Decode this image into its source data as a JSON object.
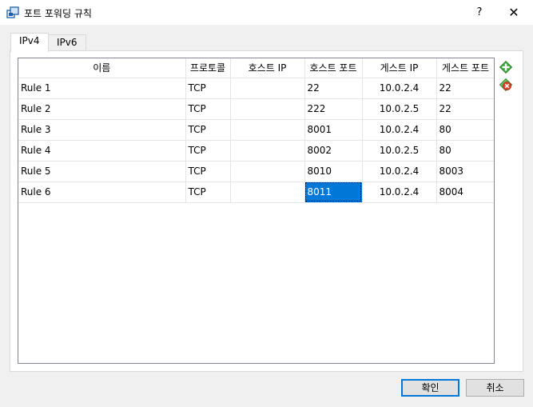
{
  "window": {
    "title": "포트 포워딩 규칙",
    "help_label": "?",
    "close_label": "✕"
  },
  "tabs": [
    {
      "label": "IPv4",
      "active": true
    },
    {
      "label": "IPv6",
      "active": false
    }
  ],
  "table": {
    "columns": [
      "이름",
      "프로토콜",
      "호스트 IP",
      "호스트 포트",
      "게스트 IP",
      "게스트 포트"
    ],
    "rows": [
      [
        "Rule 1",
        "TCP",
        "",
        "22",
        "10.0.2.4",
        "22"
      ],
      [
        "Rule 2",
        "TCP",
        "",
        "222",
        "10.0.2.5",
        "22"
      ],
      [
        "Rule 3",
        "TCP",
        "",
        "8001",
        "10.0.2.4",
        "80"
      ],
      [
        "Rule 4",
        "TCP",
        "",
        "8002",
        "10.0.2.5",
        "80"
      ],
      [
        "Rule 5",
        "TCP",
        "",
        "8010",
        "10.0.2.4",
        "8003"
      ],
      [
        "Rule 6",
        "TCP",
        "",
        "8011",
        "10.0.2.4",
        "8004"
      ]
    ],
    "selected_cell": {
      "row": 5,
      "col": 3
    }
  },
  "side_icons": {
    "add": "add-rule-icon",
    "remove": "remove-rule-icon"
  },
  "buttons": {
    "ok_label": "확인",
    "cancel_label": "취소"
  },
  "colors": {
    "selection": "#0078d7",
    "add_green": "#3fa83a",
    "remove_red": "#d9472b"
  }
}
